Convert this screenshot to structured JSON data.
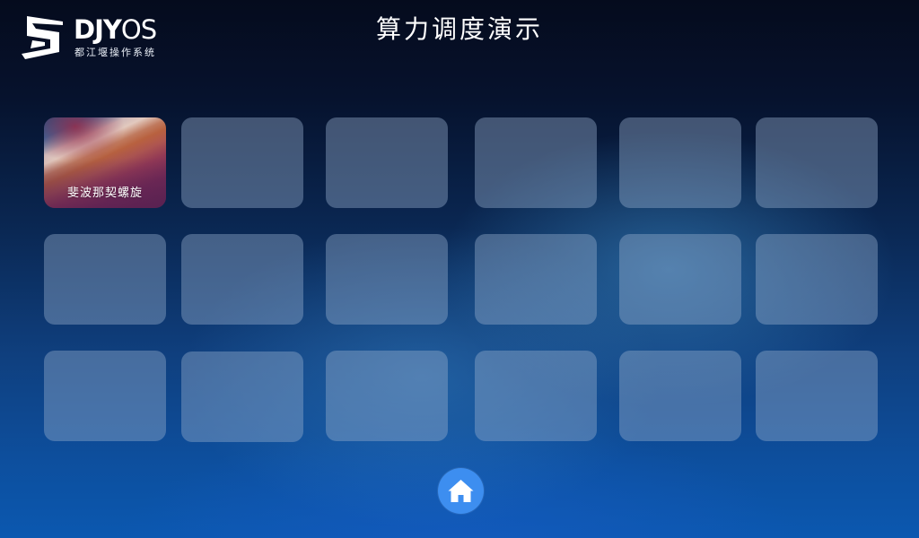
{
  "logo": {
    "word_main": "DJY",
    "word_thin": "OS",
    "subtitle": "都江堰操作系统"
  },
  "header": {
    "title": "算力调度演示"
  },
  "grid": {
    "rows": 3,
    "columns": 6,
    "tiles": [
      {
        "label": "斐波那契螺旋",
        "featured": true
      },
      {
        "label": ""
      },
      {
        "label": ""
      },
      {
        "label": ""
      },
      {
        "label": ""
      },
      {
        "label": ""
      },
      {
        "label": ""
      },
      {
        "label": ""
      },
      {
        "label": ""
      },
      {
        "label": ""
      },
      {
        "label": ""
      },
      {
        "label": ""
      },
      {
        "label": ""
      },
      {
        "label": ""
      },
      {
        "label": ""
      },
      {
        "label": ""
      },
      {
        "label": ""
      },
      {
        "label": ""
      }
    ]
  },
  "home": {
    "icon": "home-icon",
    "color": "#3d8ef0"
  },
  "colors": {
    "background_top": "#050b1d",
    "background_bottom": "#0b58b0",
    "tile": "#96afcd"
  }
}
